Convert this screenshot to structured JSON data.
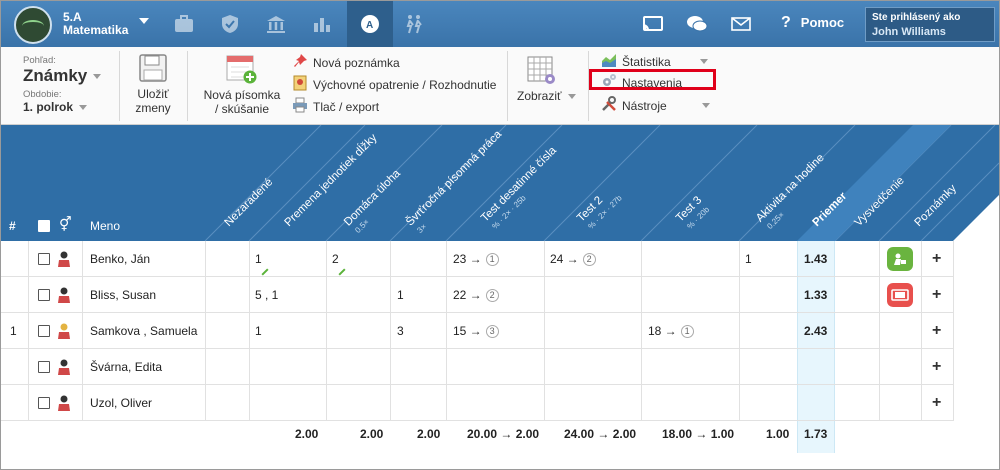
{
  "nav": {
    "class_name": "5.A",
    "subject": "Matematika",
    "help_label": "Pomoc",
    "user_caption": "Ste prihlásený ako",
    "user_name": "John Williams"
  },
  "toolbar": {
    "view_caption": "Pohľad:",
    "view_value": "Známky",
    "period_caption": "Obdobie:",
    "period_value": "1. polrok",
    "save_label_1": "Uložiť",
    "save_label_2": "zmeny",
    "new_test_label_1": "Nová písomka",
    "new_test_label_2": "/ skúšanie",
    "new_note": "Nová poznámka",
    "measure": "Výchovné opatrenie / Rozhodnutie",
    "print": "Tlač / export",
    "show": "Zobraziť",
    "stats": "Štatistika",
    "settings": "Nastavenia",
    "tools": "Nástroje"
  },
  "columns": {
    "num": "#",
    "name": "Meno",
    "nezaradene": "Nezaradené",
    "premena": "Premena jednotiek dĺžky",
    "domaca": "Domáca úloha",
    "domaca_sub": "0.5×",
    "stvrthodinova": "Švrťročná písomná práca",
    "stvrthodinova_sub": "3×",
    "test_des": "Test desatinné čísla",
    "test_des_sub": "% · 2× · 25b",
    "test2": "Test 2",
    "test2_sub": "% · 2× · 27b",
    "test3": "Test 3",
    "test3_sub": "% · 20b",
    "aktivita": "Aktivita na hodine",
    "aktivita_sub": "0.25×",
    "priemer": "Priemer",
    "vysvedcenie": "Vysvedčenie",
    "poznamky": "Poznámky"
  },
  "students": [
    {
      "num": "",
      "name": "Benko, Ján",
      "nez": "",
      "prem": "1",
      "dom": "2",
      "stv": "",
      "tdes": "23 →",
      "tdes_r": "1",
      "t2": "24 →",
      "t2_r": "2",
      "t3": "",
      "t3_r": "",
      "akt": "1",
      "avg": "1.43",
      "badge": "green"
    },
    {
      "num": "",
      "name": "Bliss, Susan",
      "nez": "",
      "prem": "5 ,  1",
      "dom": "",
      "stv": "1",
      "tdes": "22 →",
      "tdes_r": "2",
      "t2": "",
      "t2_r": "",
      "t3": "",
      "t3_r": "",
      "akt": "",
      "avg": "1.33",
      "badge": "red"
    },
    {
      "num": "1",
      "name": "Samkova , Samuela",
      "nez": "",
      "prem": "1",
      "dom": "",
      "stv": "3",
      "tdes": "15 →",
      "tdes_r": "3",
      "t2": "",
      "t2_r": "",
      "t3": "18 →",
      "t3_r": "1",
      "akt": "",
      "avg": "2.43",
      "badge": ""
    },
    {
      "num": "",
      "name": "Švárna, Edita",
      "nez": "",
      "prem": "",
      "dom": "",
      "stv": "",
      "tdes": "",
      "tdes_r": "",
      "t2": "",
      "t2_r": "",
      "t3": "",
      "t3_r": "",
      "akt": "",
      "avg": "",
      "badge": ""
    },
    {
      "num": "",
      "name": "Uzol, Oliver",
      "nez": "",
      "prem": "",
      "dom": "",
      "stv": "",
      "tdes": "",
      "tdes_r": "",
      "t2": "",
      "t2_r": "",
      "t3": "",
      "t3_r": "",
      "akt": "",
      "avg": "",
      "badge": ""
    }
  ],
  "footer": {
    "prem": "2.00",
    "dom": "2.00",
    "stv": "2.00",
    "tdes": "20.00 → 2.00",
    "t2": "24.00 → 2.00",
    "t3": "18.00 → 1.00",
    "akt": "1.00",
    "avg": "1.73"
  },
  "colors": {
    "nav": "#3a73a9",
    "header": "#2f6ea6",
    "highlight": "#e0001a",
    "badge_green": "#6ab43f",
    "badge_red": "#e8504d"
  }
}
